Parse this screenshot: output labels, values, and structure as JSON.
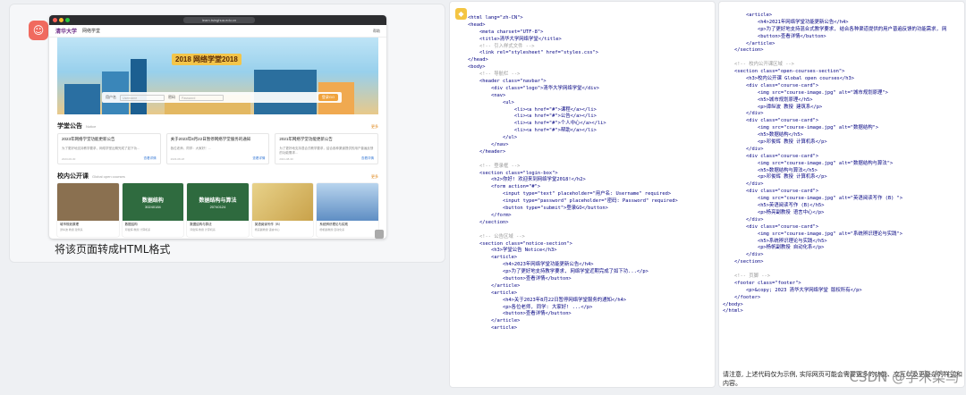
{
  "chat": {
    "caption": "将该页面转成HTML格式",
    "avatar_icon": "chat-bot-avatar"
  },
  "browser": {
    "url": "learn.tsinghua.edu.cn",
    "logo_text": "清华大学",
    "site_name": "网络学堂",
    "nav_right": "帮助",
    "banner_title": "2018 网络学堂2018",
    "login": {
      "user_label": "用户名",
      "user_placeholder": "Username",
      "pass_label": "密码",
      "pass_placeholder": "Password",
      "button": "登录GO"
    },
    "notice_section": {
      "title": "学堂公告",
      "sub": "Notice",
      "more": "更多"
    },
    "notices": [
      {
        "title": "2023年网络学堂功能更新公告",
        "body": "为了更好地支持教学要求，网络学堂近期完成了如下功...",
        "date": "2023-06-30",
        "link": "查看详情"
      },
      {
        "title": "关于2023年8月22日暂停网络学堂服务的通知",
        "body": "各位老师、同学：大家好！...",
        "date": "2023-08-18",
        "link": "查看详情"
      },
      {
        "title": "2021年网络学堂功能更新公告",
        "body": "为了更好地支持混合式教学要求，结合各种渠道提供的用户普遍反馈的功能需求...",
        "date": "2021-08-30",
        "link": "查看详情"
      }
    ],
    "course_section": {
      "title": "校内公开课",
      "sub": "Global open courses",
      "more": "更多"
    },
    "courses": [
      {
        "img_title": "",
        "img_sub": "",
        "name": "城市规划原理",
        "meta": "谭纵波 教授 建筑系",
        "color": "#8a7050"
      },
      {
        "img_title": "数据结构",
        "img_sub": "30240184",
        "name": "数据结构",
        "meta": "邓俊辉 教授 计算机系",
        "color": "#2f6b3f"
      },
      {
        "img_title": "数据结构与算法",
        "img_sub": "20740124",
        "name": "数据结构与算法",
        "meta": "邓俊辉 教授 计算机系",
        "color": "#2e6a3e"
      },
      {
        "img_title": "",
        "img_sub": "",
        "name": "英语阅读写作（B）",
        "meta": "杨亮副教授 语言中心",
        "color": "#c9a24a"
      },
      {
        "img_title": "",
        "img_sub": "",
        "name": "系统辨识理论与实践",
        "meta": "杨帆副教授 自动化系",
        "color": "#5f8ec4"
      }
    ]
  },
  "code_left": [
    {
      "t": "<html lang=\"zh-CN\">",
      "k": "tag"
    },
    {
      "t": "<head>",
      "k": "tag"
    },
    {
      "t": "    <meta charset=\"UTF-8\">",
      "k": "tag"
    },
    {
      "t": "    <title>清华大学网络学堂</title>",
      "k": "tag"
    },
    {
      "t": "    <!-- 引入样式文件 -->",
      "k": "comment"
    },
    {
      "t": "    <link rel=\"stylesheet\" href=\"styles.css\">",
      "k": "tag"
    },
    {
      "t": "</head>",
      "k": "tag"
    },
    {
      "t": "<body>",
      "k": "tag"
    },
    {
      "t": "    <!-- 导航栏 -->",
      "k": "comment"
    },
    {
      "t": "    <header class=\"navbar\">",
      "k": "tag"
    },
    {
      "t": "        <div class=\"logo\">清华大学网络学堂</div>",
      "k": "tag"
    },
    {
      "t": "        <nav>",
      "k": "tag"
    },
    {
      "t": "            <ul>",
      "k": "tag"
    },
    {
      "t": "                <li><a href=\"#\">课程</a></li>",
      "k": "tag"
    },
    {
      "t": "                <li><a href=\"#\">公告</a></li>",
      "k": "tag"
    },
    {
      "t": "                <li><a href=\"#\">个人中心</a></li>",
      "k": "tag"
    },
    {
      "t": "                <li><a href=\"#\">帮助</a></li>",
      "k": "tag"
    },
    {
      "t": "            </ul>",
      "k": "tag"
    },
    {
      "t": "        </nav>",
      "k": "tag"
    },
    {
      "t": "    </header>",
      "k": "tag"
    },
    {
      "t": "",
      "k": "tag"
    },
    {
      "t": "    <!-- 登录框 -->",
      "k": "comment"
    },
    {
      "t": "    <section class=\"login-box\">",
      "k": "tag"
    },
    {
      "t": "        <h2>你好! 欢迎来到网络学堂2018!</h2>",
      "k": "tag"
    },
    {
      "t": "        <form action=\"#\">",
      "k": "tag"
    },
    {
      "t": "            <input type=\"text\" placeholder=\"用户名: Username\" required>",
      "k": "tag"
    },
    {
      "t": "            <input type=\"password\" placeholder=\"密码: Password\" required>",
      "k": "tag"
    },
    {
      "t": "            <button type=\"submit\">登录GO</button>",
      "k": "tag"
    },
    {
      "t": "        </form>",
      "k": "tag"
    },
    {
      "t": "    </section>",
      "k": "tag"
    },
    {
      "t": "",
      "k": "tag"
    },
    {
      "t": "    <!-- 公告区域 -->",
      "k": "comment"
    },
    {
      "t": "    <section class=\"notice-section\">",
      "k": "tag"
    },
    {
      "t": "        <h3>学堂公告 Notice</h3>",
      "k": "tag"
    },
    {
      "t": "        <article>",
      "k": "tag"
    },
    {
      "t": "            <h4>2023年网络学堂功能更新公告</h4>",
      "k": "tag"
    },
    {
      "t": "            <p>为了更好地支持教学要求, 网络学堂近期完成了如下功...</p>",
      "k": "tag"
    },
    {
      "t": "            <button>查看详情</button>",
      "k": "tag"
    },
    {
      "t": "        </article>",
      "k": "tag"
    },
    {
      "t": "        <article>",
      "k": "tag"
    },
    {
      "t": "            <h4>关于2023年8月22日暂停网络学堂服务的通知</h4>",
      "k": "tag"
    },
    {
      "t": "            <p>各位老师, 同学: 大家好! ...</p>",
      "k": "tag"
    },
    {
      "t": "            <button>查看详情</button>",
      "k": "tag"
    },
    {
      "t": "        </article>",
      "k": "tag"
    },
    {
      "t": "        <article>",
      "k": "tag"
    }
  ],
  "code_right": [
    {
      "t": "        <article>",
      "k": "tag"
    },
    {
      "t": "            <h4>2021年网络学堂功能更新公告</h4>",
      "k": "tag"
    },
    {
      "t": "            <p>为了更好地支持混合式教学要求, 结合各种渠道提供的用户普遍反馈的功能需求, 网",
      "k": "tag"
    },
    {
      "t": "            <button>查看详情</button>",
      "k": "tag"
    },
    {
      "t": "        </article>",
      "k": "tag"
    },
    {
      "t": "    </section>",
      "k": "tag"
    },
    {
      "t": "",
      "k": "tag"
    },
    {
      "t": "    <!-- 校内公开课区域 -->",
      "k": "comment"
    },
    {
      "t": "    <section class=\"open-courses-section\">",
      "k": "tag"
    },
    {
      "t": "        <h3>校内公开课 Global open courses</h3>",
      "k": "tag"
    },
    {
      "t": "        <div class=\"course-card\">",
      "k": "tag"
    },
    {
      "t": "            <img src=\"course-image.jpg\" alt=\"城市规划原理\">",
      "k": "tag"
    },
    {
      "t": "            <h5>城市规划原理</h5>",
      "k": "tag"
    },
    {
      "t": "            <p>谭纵波 教授 建筑系</p>",
      "k": "tag"
    },
    {
      "t": "        </div>",
      "k": "tag"
    },
    {
      "t": "        <div class=\"course-card\">",
      "k": "tag"
    },
    {
      "t": "            <img src=\"course-image.jpg\" alt=\"数据结构\">",
      "k": "tag"
    },
    {
      "t": "            <h5>数据结构</h5>",
      "k": "tag"
    },
    {
      "t": "            <p>邓俊辉 教授 计算机系</p>",
      "k": "tag"
    },
    {
      "t": "        </div>",
      "k": "tag"
    },
    {
      "t": "        <div class=\"course-card\">",
      "k": "tag"
    },
    {
      "t": "            <img src=\"course-image.jpg\" alt=\"数据结构与算法\">",
      "k": "tag"
    },
    {
      "t": "            <h5>数据结构与算法</h5>",
      "k": "tag"
    },
    {
      "t": "            <p>邓俊辉 教授 计算机系</p>",
      "k": "tag"
    },
    {
      "t": "        </div>",
      "k": "tag"
    },
    {
      "t": "        <div class=\"course-card\">",
      "k": "tag"
    },
    {
      "t": "            <img src=\"course-image.jpg\" alt=\"英语阅读写作 (B) \">",
      "k": "tag"
    },
    {
      "t": "            <h5>英语阅读写作 (B)</h5>",
      "k": "tag"
    },
    {
      "t": "            <p>杨亮副教授 语言中心</p>",
      "k": "tag"
    },
    {
      "t": "        </div>",
      "k": "tag"
    },
    {
      "t": "        <div class=\"course-card\">",
      "k": "tag"
    },
    {
      "t": "            <img src=\"course-image.jpg\" alt=\"系统辨识理论与实践\">",
      "k": "tag"
    },
    {
      "t": "            <h5>系统辨识理论与实践</h5>",
      "k": "tag"
    },
    {
      "t": "            <p>杨帆副教授 自动化系</p>",
      "k": "tag"
    },
    {
      "t": "        </div>",
      "k": "tag"
    },
    {
      "t": "    </section>",
      "k": "tag"
    },
    {
      "t": "",
      "k": "tag"
    },
    {
      "t": "    <!-- 页脚 -->",
      "k": "comment"
    },
    {
      "t": "    <footer class=\"footer\">",
      "k": "tag"
    },
    {
      "t": "        <p>&copy; 2023 清华大学网络学堂 版权所有</p>",
      "k": "tag"
    },
    {
      "t": "    </footer>",
      "k": "tag"
    },
    {
      "t": "</body>",
      "k": "tag"
    },
    {
      "t": "</html>",
      "k": "tag"
    }
  ],
  "note": "请注意, 上述代码仅为示例, 实际网页可能会需要更多的功能、交互以及更复杂的样式和内容。",
  "watermark": "CSDN @学术菜鸟"
}
